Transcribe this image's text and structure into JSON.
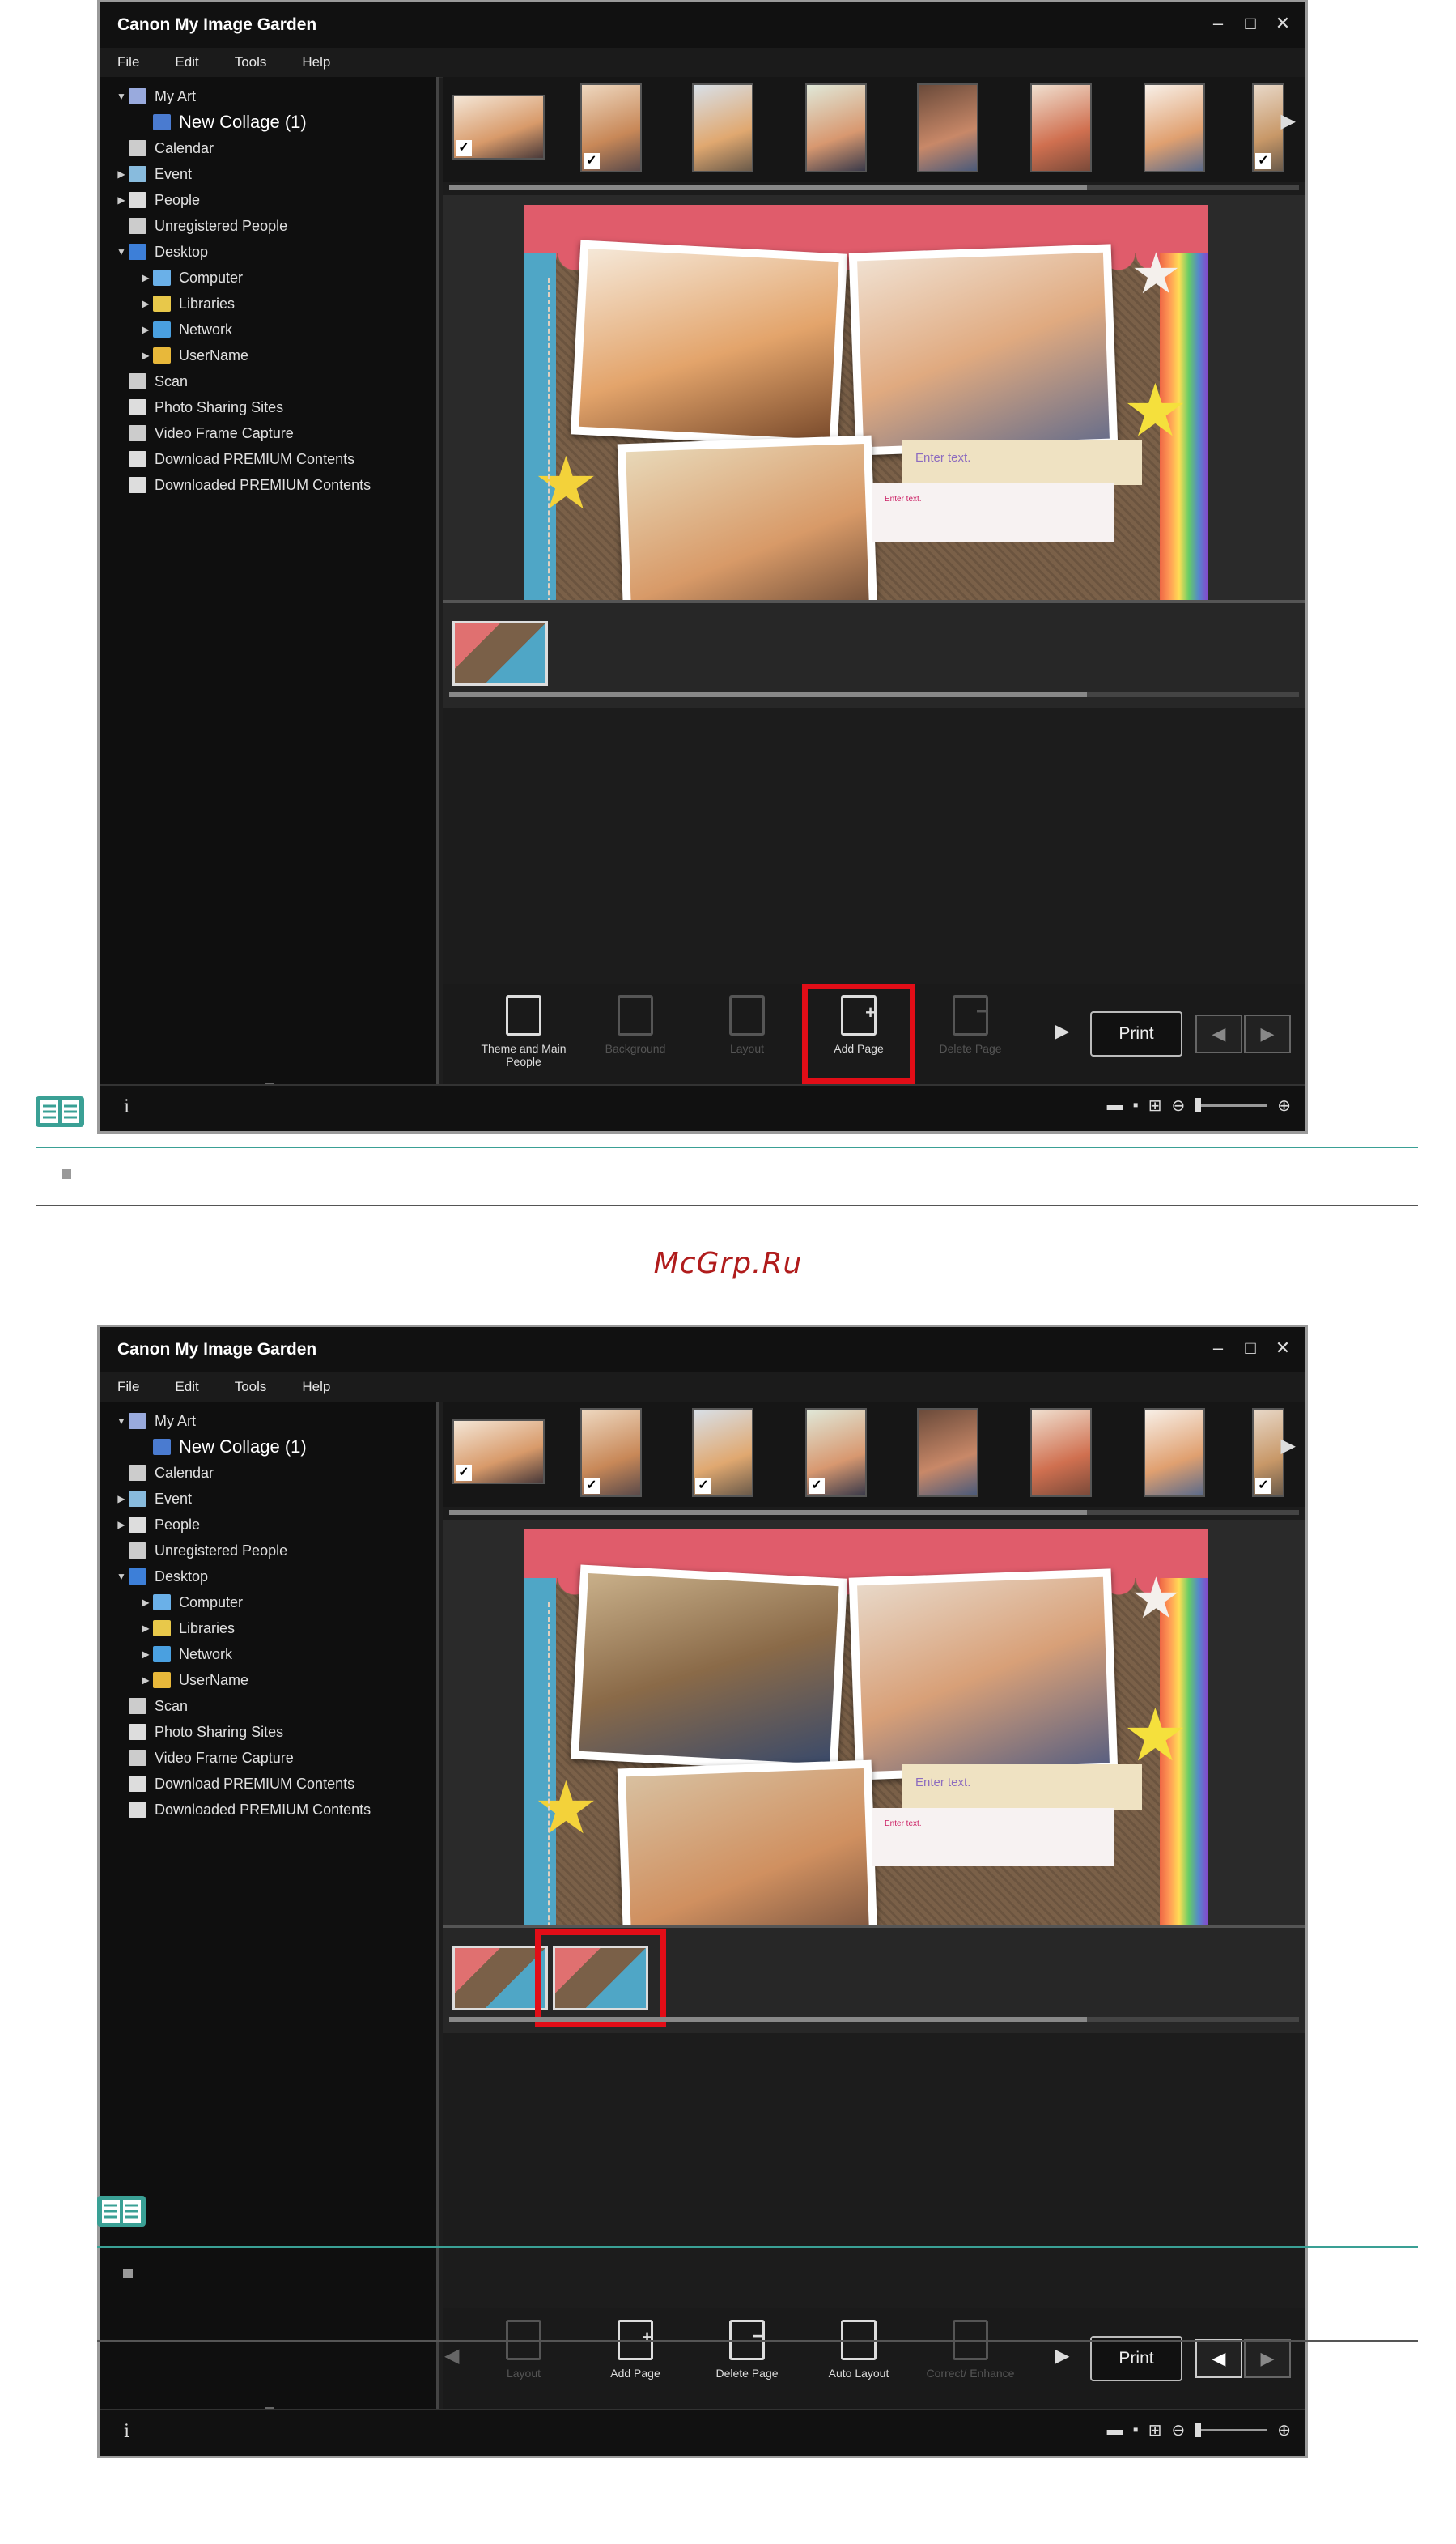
{
  "windows": [
    {
      "title": "Canon My Image Garden",
      "menu": [
        "File",
        "Edit",
        "Tools",
        "Help"
      ],
      "sidebar": [
        {
          "label": "My Art",
          "arrow": "▼",
          "indent": 0
        },
        {
          "label": "New Collage (1)",
          "arrow": "",
          "indent": 1,
          "selected": true
        },
        {
          "label": "Calendar",
          "arrow": "",
          "indent": 0
        },
        {
          "label": "Event",
          "arrow": "▶",
          "indent": 0
        },
        {
          "label": "People",
          "arrow": "▶",
          "indent": 0
        },
        {
          "label": "Unregistered People",
          "arrow": "",
          "indent": 0
        },
        {
          "label": "Desktop",
          "arrow": "▼",
          "indent": 0
        },
        {
          "label": "Computer",
          "arrow": "▶",
          "indent": 1
        },
        {
          "label": "Libraries",
          "arrow": "▶",
          "indent": 1
        },
        {
          "label": "Network",
          "arrow": "▶",
          "indent": 1
        },
        {
          "label": "UserName",
          "arrow": "▶",
          "indent": 1
        },
        {
          "label": "Scan",
          "arrow": "",
          "indent": 0
        },
        {
          "label": "Photo Sharing Sites",
          "arrow": "",
          "indent": 0
        },
        {
          "label": "Video Frame Capture",
          "arrow": "",
          "indent": 0
        },
        {
          "label": "Download PREMIUM Contents",
          "arrow": "",
          "indent": 0
        },
        {
          "label": "Downloaded PREMIUM Contents",
          "arrow": "",
          "indent": 0
        }
      ],
      "collage_text": {
        "enter_text": "Enter text.",
        "enter_text_small": "Enter text."
      },
      "tools": [
        {
          "label": "Theme and Main People",
          "enabled": true,
          "kind": "theme"
        },
        {
          "label": "Background",
          "enabled": false,
          "kind": "bg"
        },
        {
          "label": "Layout",
          "enabled": false,
          "kind": "layout"
        },
        {
          "label": "Add Page",
          "enabled": true,
          "kind": "add"
        },
        {
          "label": "Delete Page",
          "enabled": false,
          "kind": "delete"
        }
      ],
      "print_label": "Print",
      "status_info": "i",
      "page_count": 1
    },
    {
      "title": "Canon My Image Garden",
      "menu": [
        "File",
        "Edit",
        "Tools",
        "Help"
      ],
      "sidebar": [
        {
          "label": "My Art",
          "arrow": "▼",
          "indent": 0
        },
        {
          "label": "New Collage (1)",
          "arrow": "",
          "indent": 1,
          "selected": true
        },
        {
          "label": "Calendar",
          "arrow": "",
          "indent": 0
        },
        {
          "label": "Event",
          "arrow": "▶",
          "indent": 0
        },
        {
          "label": "People",
          "arrow": "▶",
          "indent": 0
        },
        {
          "label": "Unregistered People",
          "arrow": "",
          "indent": 0
        },
        {
          "label": "Desktop",
          "arrow": "▼",
          "indent": 0
        },
        {
          "label": "Computer",
          "arrow": "▶",
          "indent": 1
        },
        {
          "label": "Libraries",
          "arrow": "▶",
          "indent": 1
        },
        {
          "label": "Network",
          "arrow": "▶",
          "indent": 1
        },
        {
          "label": "UserName",
          "arrow": "▶",
          "indent": 1
        },
        {
          "label": "Scan",
          "arrow": "",
          "indent": 0
        },
        {
          "label": "Photo Sharing Sites",
          "arrow": "",
          "indent": 0
        },
        {
          "label": "Video Frame Capture",
          "arrow": "",
          "indent": 0
        },
        {
          "label": "Download PREMIUM Contents",
          "arrow": "",
          "indent": 0
        },
        {
          "label": "Downloaded PREMIUM Contents",
          "arrow": "",
          "indent": 0
        }
      ],
      "collage_text": {
        "enter_text": "Enter text.",
        "enter_text_small": "Enter text."
      },
      "tools": [
        {
          "label": "Layout",
          "enabled": false,
          "kind": "layout"
        },
        {
          "label": "Add Page",
          "enabled": true,
          "kind": "add"
        },
        {
          "label": "Delete Page",
          "enabled": true,
          "kind": "delete"
        },
        {
          "label": "Auto Layout",
          "enabled": true,
          "kind": "auto"
        },
        {
          "label": "Correct/ Enhance",
          "enabled": false,
          "kind": "correct"
        }
      ],
      "print_label": "Print",
      "status_info": "i",
      "page_count": 2
    }
  ],
  "watermark": "McGrp.Ru",
  "colors": {
    "accent_red": "#e20d17",
    "note_teal": "#3aa095"
  }
}
